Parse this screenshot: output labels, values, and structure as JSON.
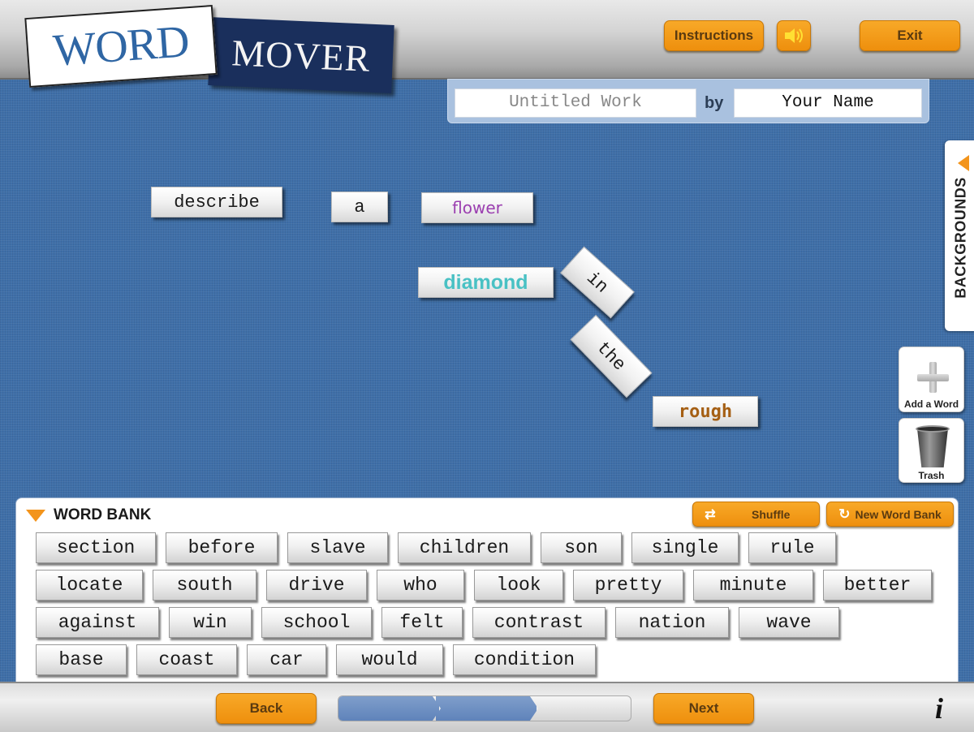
{
  "app": {
    "logo_word": "WORD",
    "logo_mover": "MOVER"
  },
  "header": {
    "instructions_label": "Instructions",
    "sound_icon": "speaker-icon",
    "exit_label": "Exit"
  },
  "title_bar": {
    "title_placeholder": "Untitled Work",
    "by_label": "by",
    "author_value": "Your Name"
  },
  "canvas": {
    "tiles": [
      {
        "text": "describe",
        "color": "#1a1a1a",
        "rotation_deg": 0
      },
      {
        "text": "a",
        "color": "#1a1a1a",
        "rotation_deg": 0
      },
      {
        "text": "flower",
        "color": "#9b3fb0",
        "rotation_deg": 0
      },
      {
        "text": "diamond",
        "color": "#49c1c4",
        "rotation_deg": 0
      },
      {
        "text": "in",
        "color": "#1a1a1a",
        "rotation_deg": 42
      },
      {
        "text": "the",
        "color": "#1a1a1a",
        "rotation_deg": 46
      },
      {
        "text": "rough",
        "color": "#a55f14",
        "rotation_deg": 0
      }
    ]
  },
  "side_panel": {
    "backgrounds_label": "BACKGROUNDS",
    "add_word_label": "Add a Word",
    "trash_label": "Trash"
  },
  "word_bank": {
    "title": "WORD BANK",
    "shuffle_label": "Shuffle",
    "new_bank_label": "New Word Bank",
    "rows": [
      [
        "section",
        "before",
        "slave",
        "children",
        "son",
        "single",
        "rule"
      ],
      [
        "locate",
        "south",
        "drive",
        "who",
        "look",
        "pretty",
        "minute",
        "better"
      ],
      [
        "against",
        "win",
        "school",
        "felt",
        "contrast",
        "nation",
        "wave"
      ],
      [
        "base",
        "coast",
        "car",
        "would",
        "condition"
      ]
    ]
  },
  "footer": {
    "back_label": "Back",
    "next_label": "Next",
    "progress": {
      "completed_steps": 2,
      "total_steps": 3
    },
    "info_label": "i"
  },
  "colors": {
    "accent_orange": "#f3941b",
    "canvas_blue": "#3f6fa8",
    "progress_blue": "#6b8ec2"
  }
}
